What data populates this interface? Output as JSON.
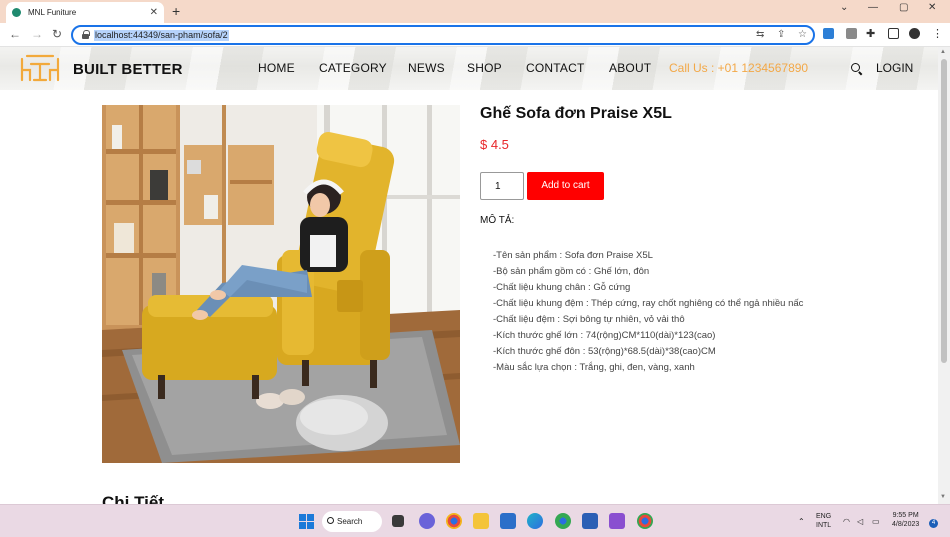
{
  "browser": {
    "tab_title": "MNL Funiture",
    "tab_close": "✕",
    "new_tab": "+",
    "url": "localhost:44349/san-pham/sofa/2",
    "window_controls": [
      "⌄",
      "—",
      "▢",
      "✕"
    ]
  },
  "site": {
    "brand": "BUILT BETTER",
    "nav": [
      "HOME",
      "CATEGORY",
      "NEWS",
      "SHOP",
      "CONTACT",
      "ABOUT"
    ],
    "phone": "Call Us : +01 1234567890",
    "login": "LOGIN"
  },
  "product": {
    "title": "Ghế Sofa đơn Praise X5L",
    "price": "$ 4.5",
    "quantity": "1",
    "add_to_cart": "Add to cart",
    "description_label": "MÔ TẢ:",
    "description": [
      "-Tên sản phẩm : Sofa đơn Praise X5L",
      "-Bộ sản phẩm gồm có : Ghế lớn, đôn",
      "-Chất liệu khung chân : Gỗ cứng",
      "-Chất liệu khung đệm : Thép cứng, ray chốt nghiêng có thể ngả nhiều nấc",
      "-Chất liệu đệm : Sợi bông tự nhiên, vỏ vải thô",
      "-Kích thước ghế lớn : 74(rộng)CM*110(dài)*123(cao)",
      "-Kích thước ghế đôn : 53(rộng)*68.5(dài)*38(cao)CM",
      "-Màu sắc lựa chọn : Trắng, ghi, đen, vàng, xanh"
    ],
    "detail_heading": "Chi Tiết"
  },
  "taskbar": {
    "search": "Search",
    "language": "ENG",
    "layout": "INTL",
    "time": "9:55 PM",
    "date": "4/8/2023",
    "notifications": "4"
  },
  "colors": {
    "accent_red": "#ff0000",
    "phone_orange": "#f3a847",
    "sofa_yellow": "#e0b52a"
  }
}
